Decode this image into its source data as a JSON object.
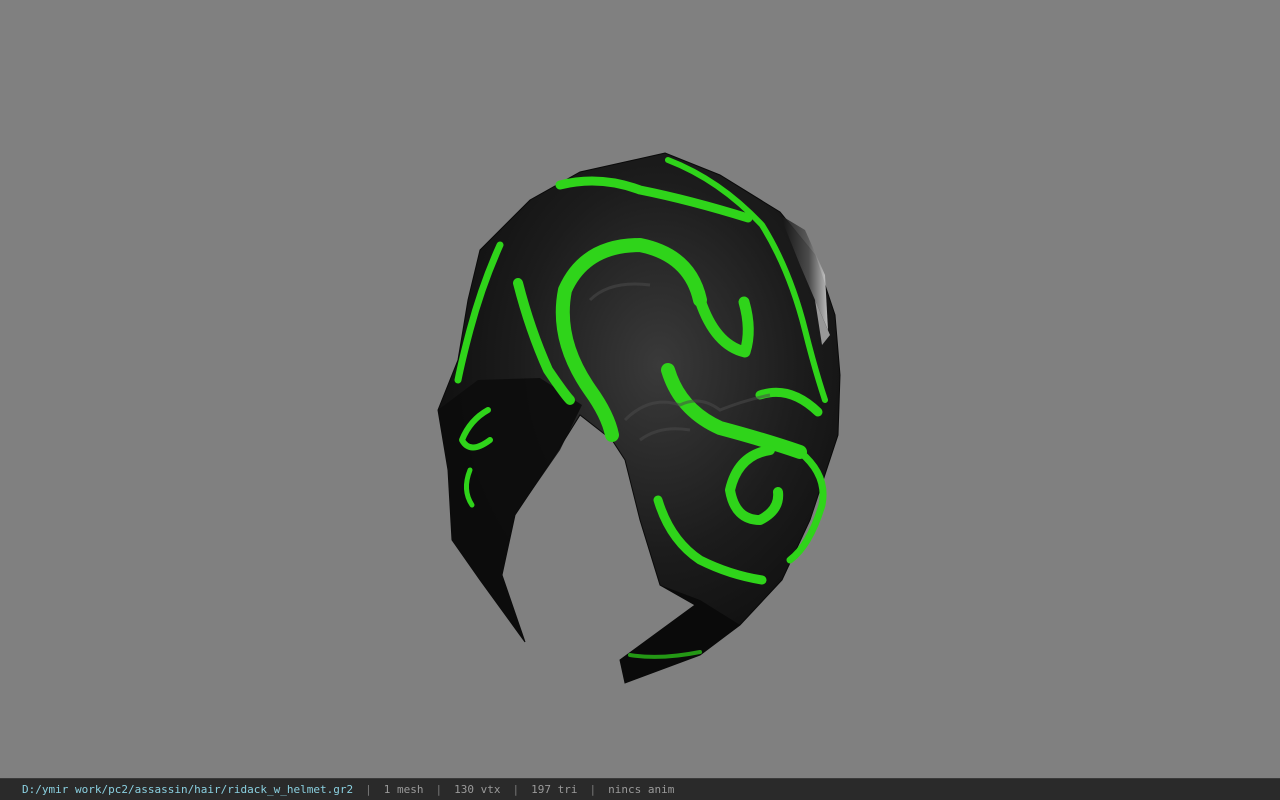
{
  "status_bar": {
    "file_path": "D:/ymir work/pc2/assassin/hair/ridack_w_helmet.gr2",
    "separator": "|",
    "mesh_count": "1 mesh",
    "vertex_count": "130 vtx",
    "triangle_count": "197 tri",
    "anim_status": "nincs anim"
  },
  "colors": {
    "viewport_bg": "#808080",
    "helmet_dark": "#141414",
    "glow_green": "#2fd41a",
    "statusbar_bg": "#2a2a2a",
    "path_text": "#8ad0e0"
  }
}
